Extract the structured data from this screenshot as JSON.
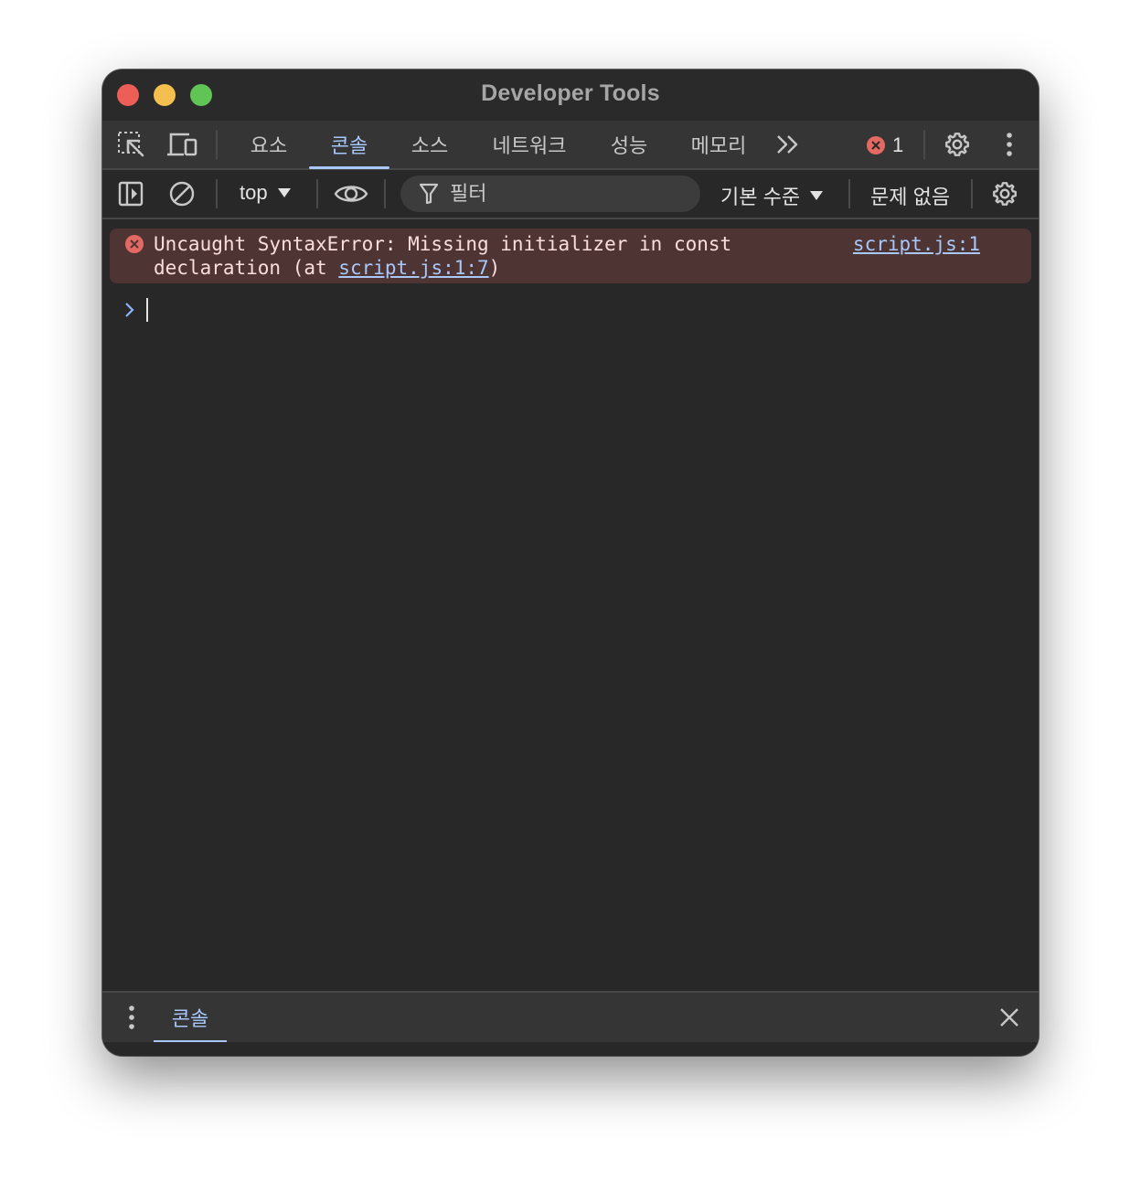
{
  "window": {
    "title": "Developer Tools"
  },
  "main_tabs": [
    {
      "label": "요소"
    },
    {
      "label": "콘솔"
    },
    {
      "label": "소스"
    },
    {
      "label": "네트워크"
    },
    {
      "label": "성능"
    },
    {
      "label": "메모리"
    }
  ],
  "active_tab": "콘솔",
  "error_count": "1",
  "toolbar": {
    "context": "top",
    "filter_placeholder": "필터",
    "levels": "기본 수준",
    "issues": "문제 없음"
  },
  "console": {
    "error_line1": "Uncaught SyntaxError: Missing initializer in const",
    "error_line2_prefix": "declaration (at ",
    "error_link": "script.js:1:7",
    "error_line2_suffix": ")",
    "source_link": "script.js:1"
  },
  "drawer": {
    "tab_label": "콘솔"
  },
  "colors": {
    "accent": "#a8c7fa",
    "error_bg": "#4e3534",
    "error_icon": "#e46962",
    "panel_bg": "#282828",
    "toolbar_bg": "#353535"
  }
}
